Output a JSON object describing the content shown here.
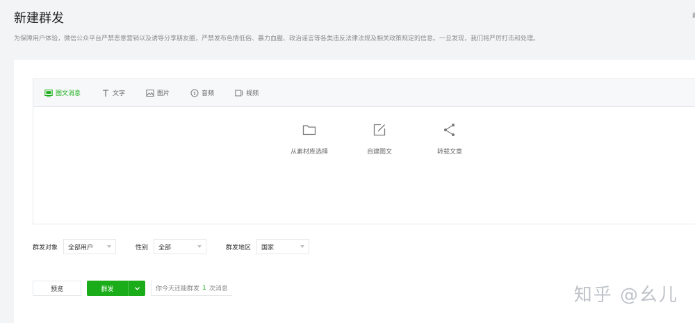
{
  "page": {
    "title": "新建群发",
    "description": "为保障用户体验，微信公众平台严禁恶意营销以及诱导分享朋友圈，严禁发布色情低俗、暴力血腥、政治谣言等各类违反法律法规及相关政策规定的信息。一旦发现，我们将严厉打击和处理。",
    "edge_mark": "群"
  },
  "editor": {
    "tabs": [
      {
        "label": "图文消息",
        "icon": "article-icon",
        "active": true
      },
      {
        "label": "文字",
        "icon": "text-icon",
        "active": false
      },
      {
        "label": "图片",
        "icon": "image-icon",
        "active": false
      },
      {
        "label": "音频",
        "icon": "audio-icon",
        "active": false
      },
      {
        "label": "视频",
        "icon": "video-icon",
        "active": false
      }
    ],
    "choices": [
      {
        "label": "从素材库选择",
        "icon": "folder-icon"
      },
      {
        "label": "自建图文",
        "icon": "edit-icon"
      },
      {
        "label": "转载文章",
        "icon": "share-icon"
      }
    ]
  },
  "filters": {
    "audience": {
      "label": "群发对象",
      "value": "全部用户"
    },
    "gender": {
      "label": "性别",
      "value": "全部"
    },
    "region": {
      "label": "群发地区",
      "value": "国家"
    }
  },
  "actions": {
    "preview_label": "预览",
    "send_label": "群发",
    "quota_prefix": "你今天还能群发",
    "quota_count": "1",
    "quota_suffix": "次消息"
  },
  "colors": {
    "accent": "#1aad19",
    "background": "#f3f4f6"
  },
  "watermark": "知乎 @幺儿"
}
